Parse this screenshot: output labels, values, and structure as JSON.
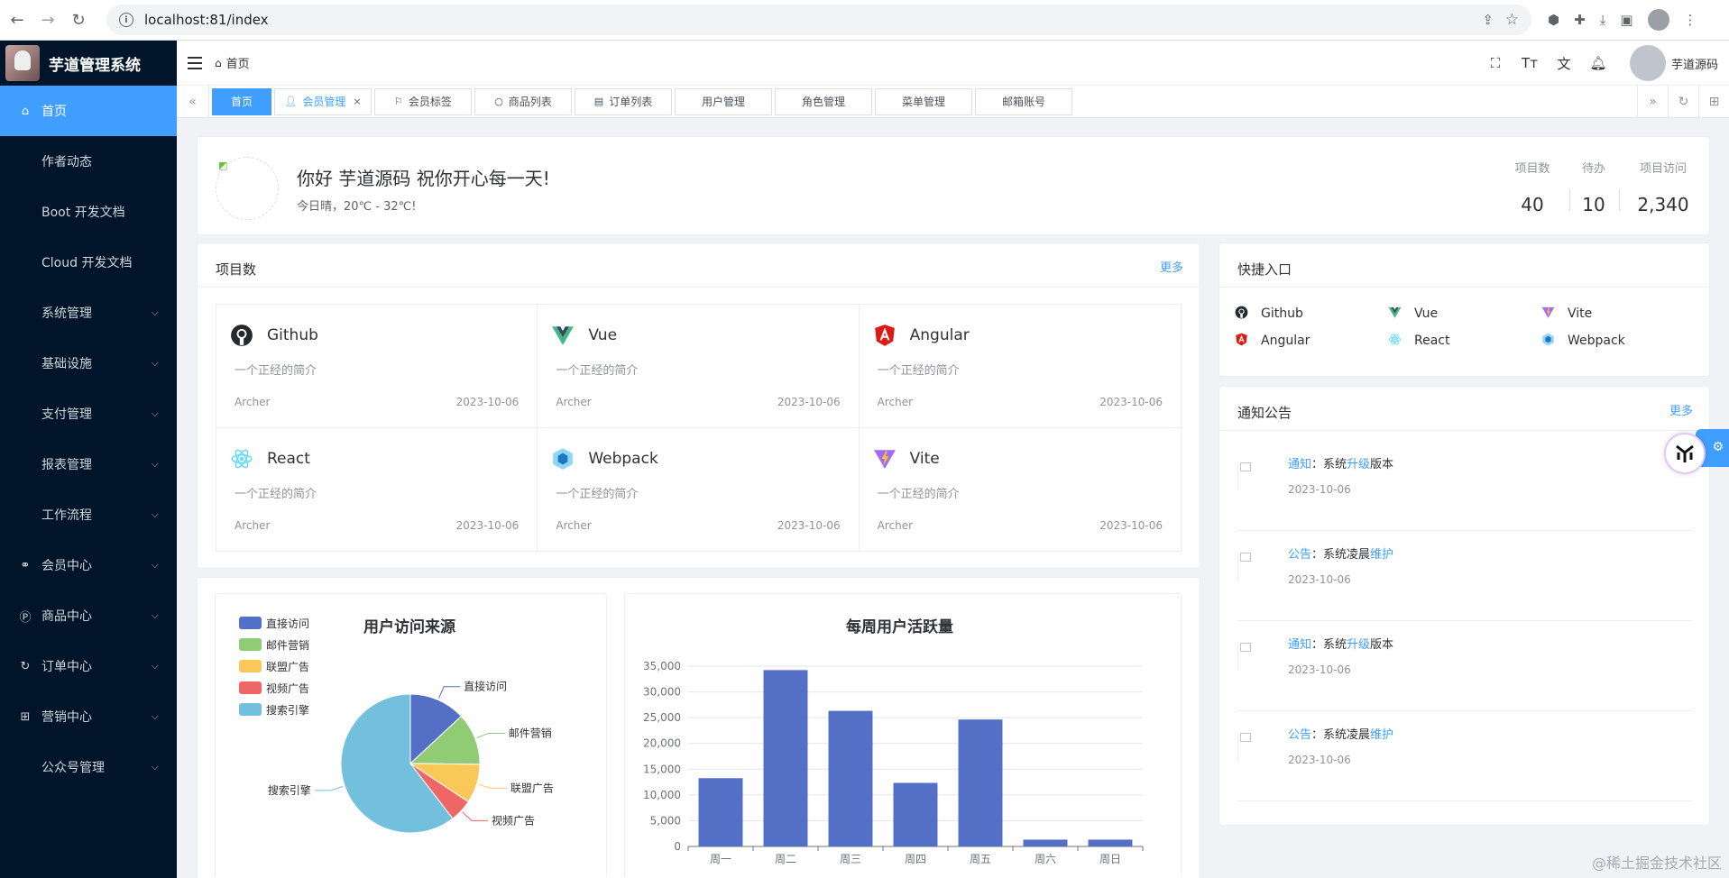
{
  "browser": {
    "url": "localhost:81/index"
  },
  "app": {
    "title": "芋道管理系统"
  },
  "sidebar": {
    "items": [
      {
        "label": "首页",
        "icon": "home-icon",
        "active": true
      },
      {
        "label": "作者动态"
      },
      {
        "label": "Boot 开发文档"
      },
      {
        "label": "Cloud 开发文档"
      },
      {
        "label": "系统管理",
        "submenu": true
      },
      {
        "label": "基础设施",
        "submenu": true
      },
      {
        "label": "支付管理",
        "submenu": true
      },
      {
        "label": "报表管理",
        "submenu": true
      },
      {
        "label": "工作流程",
        "submenu": true
      },
      {
        "label": "会员中心",
        "submenu": true,
        "icon": "member-icon"
      },
      {
        "label": "商品中心",
        "submenu": true,
        "icon": "product-icon"
      },
      {
        "label": "订单中心",
        "submenu": true,
        "icon": "order-icon"
      },
      {
        "label": "营销中心",
        "submenu": true,
        "icon": "marketing-icon"
      },
      {
        "label": "公众号管理",
        "submenu": true
      }
    ]
  },
  "header": {
    "breadcrumb": "首页",
    "username": "芋道源码"
  },
  "tabs": [
    {
      "label": "首页",
      "active": true
    },
    {
      "label": "会员管理",
      "icon": "user-icon",
      "closable": true,
      "current": true
    },
    {
      "label": "会员标签",
      "icon": "bookmark-icon"
    },
    {
      "label": "商品列表",
      "icon": "circle-icon"
    },
    {
      "label": "订单列表",
      "icon": "doc-icon"
    },
    {
      "label": "用户管理"
    },
    {
      "label": "角色管理"
    },
    {
      "label": "菜单管理"
    },
    {
      "label": "邮箱账号"
    }
  ],
  "welcome": {
    "greeting": "你好 芋道源码 祝你开心每一天!",
    "weather": "今日晴，20℃ - 32℃!",
    "stats": [
      {
        "label": "项目数",
        "value": "40"
      },
      {
        "label": "待办",
        "value": "10"
      },
      {
        "label": "项目访问",
        "value": "2,340"
      }
    ]
  },
  "projects": {
    "title": "项目数",
    "more": "更多",
    "items": [
      {
        "name": "Github",
        "desc": "一个正经的简介",
        "author": "Archer",
        "date": "2023-10-06",
        "icon": "github-icon",
        "color": "#24292e"
      },
      {
        "name": "Vue",
        "desc": "一个正经的简介",
        "author": "Archer",
        "date": "2023-10-06",
        "icon": "vue-icon",
        "color": "#42b883"
      },
      {
        "name": "Angular",
        "desc": "一个正经的简介",
        "author": "Archer",
        "date": "2023-10-06",
        "icon": "angular-icon",
        "color": "#dd1b16"
      },
      {
        "name": "React",
        "desc": "一个正经的简介",
        "author": "Archer",
        "date": "2023-10-06",
        "icon": "react-icon",
        "color": "#61dafb"
      },
      {
        "name": "Webpack",
        "desc": "一个正经的简介",
        "author": "Archer",
        "date": "2023-10-06",
        "icon": "webpack-icon",
        "color": "#2b7bd6"
      },
      {
        "name": "Vite",
        "desc": "一个正经的简介",
        "author": "Archer",
        "date": "2023-10-06",
        "icon": "vite-icon",
        "color": "#9f6bff"
      }
    ]
  },
  "quick": {
    "title": "快捷入口",
    "items": [
      {
        "label": "Github",
        "icon": "github-icon"
      },
      {
        "label": "Vue",
        "icon": "vue-icon"
      },
      {
        "label": "Vite",
        "icon": "vite-icon"
      },
      {
        "label": "Angular",
        "icon": "angular-icon"
      },
      {
        "label": "React",
        "icon": "react-icon"
      },
      {
        "label": "Webpack",
        "icon": "webpack-icon"
      }
    ]
  },
  "notice": {
    "title": "通知公告",
    "more": "更多",
    "items": [
      {
        "type": "通知",
        "sep": "：系统",
        "key": "升级",
        "tail": "版本",
        "date": "2023-10-06"
      },
      {
        "type": "公告",
        "sep": "：系统凌晨",
        "key": "维护",
        "tail": "",
        "date": "2023-10-06"
      },
      {
        "type": "通知",
        "sep": "：系统",
        "key": "升级",
        "tail": "版本",
        "date": "2023-10-06"
      },
      {
        "type": "公告",
        "sep": "：系统凌晨",
        "key": "维护",
        "tail": "",
        "date": "2023-10-06"
      }
    ]
  },
  "chart_data": [
    {
      "type": "pie",
      "title": "用户访问来源",
      "categories": [
        "直接访问",
        "邮件营销",
        "联盟广告",
        "视频广告",
        "搜索引擎"
      ],
      "values": [
        335,
        310,
        234,
        135,
        1548
      ],
      "colors": [
        "#5470c6",
        "#91cc75",
        "#fac858",
        "#ee6666",
        "#73c0de"
      ],
      "legend": "top-left"
    },
    {
      "type": "bar",
      "title": "每周用户活跃量",
      "categories": [
        "周一",
        "周二",
        "周三",
        "周四",
        "周五",
        "周六",
        "周日"
      ],
      "values": [
        13253,
        34235,
        26321,
        12340,
        24643,
        1322,
        1324
      ],
      "ylim": [
        0,
        35000
      ],
      "yticks": [
        "0",
        "5,000",
        "10,000",
        "15,000",
        "20,000",
        "25,000",
        "30,000",
        "35,000"
      ],
      "color": "#5470c6",
      "grid": true
    }
  ],
  "watermark": "@稀土掘金技术社区"
}
